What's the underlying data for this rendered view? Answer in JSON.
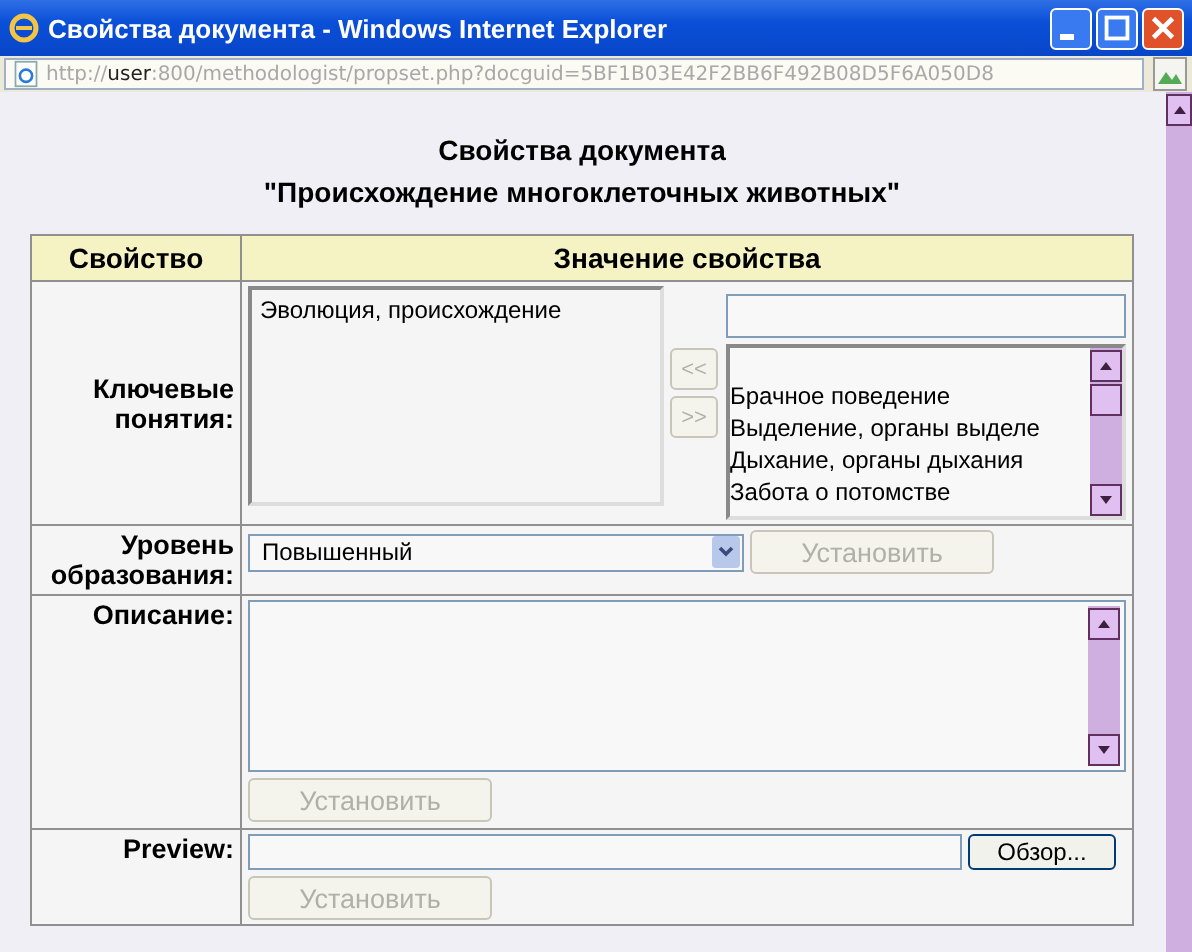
{
  "window": {
    "title": "Свойства документа - Windows Internet Explorer"
  },
  "address_bar": {
    "scheme": "http://",
    "host": "user",
    "rest": ":800/methodologist/propset.php?docguid=5BF1B03E42F2BB6F492B08D5F6A050D8"
  },
  "page": {
    "title_lines": [
      "Свойства документа",
      "\"Происхождение многоклеточных животных\""
    ],
    "table": {
      "columns": [
        "Свойство",
        "Значение свойства"
      ],
      "keywords": {
        "label": "Ключевые понятия:",
        "chosen": [
          "Эволюция, происхождение"
        ],
        "add_button": {
          "label": "<<",
          "disabled": true
        },
        "remove_button": {
          "label": ">>",
          "disabled": true
        },
        "available": [
          {
            "label": "Брачное поведение",
            "selected": false
          },
          {
            "label": "Выделение, органы выделе",
            "selected": false
          },
          {
            "label": "Дыхание, органы дыхания",
            "selected": false
          },
          {
            "label": "Забота о потомстве",
            "selected": false
          }
        ]
      },
      "education_level": {
        "label": "Уровень образования:",
        "value": "Повышенный",
        "button": {
          "label": "Установить",
          "disabled": true
        }
      },
      "description": {
        "label": "Описание:",
        "button": {
          "label": "Установить",
          "disabled": true
        }
      },
      "preview": {
        "label": "Preview:",
        "browse_button": {
          "label": "Обзор...",
          "disabled": false
        },
        "button": {
          "label": "Установить",
          "disabled": true
        }
      }
    }
  }
}
